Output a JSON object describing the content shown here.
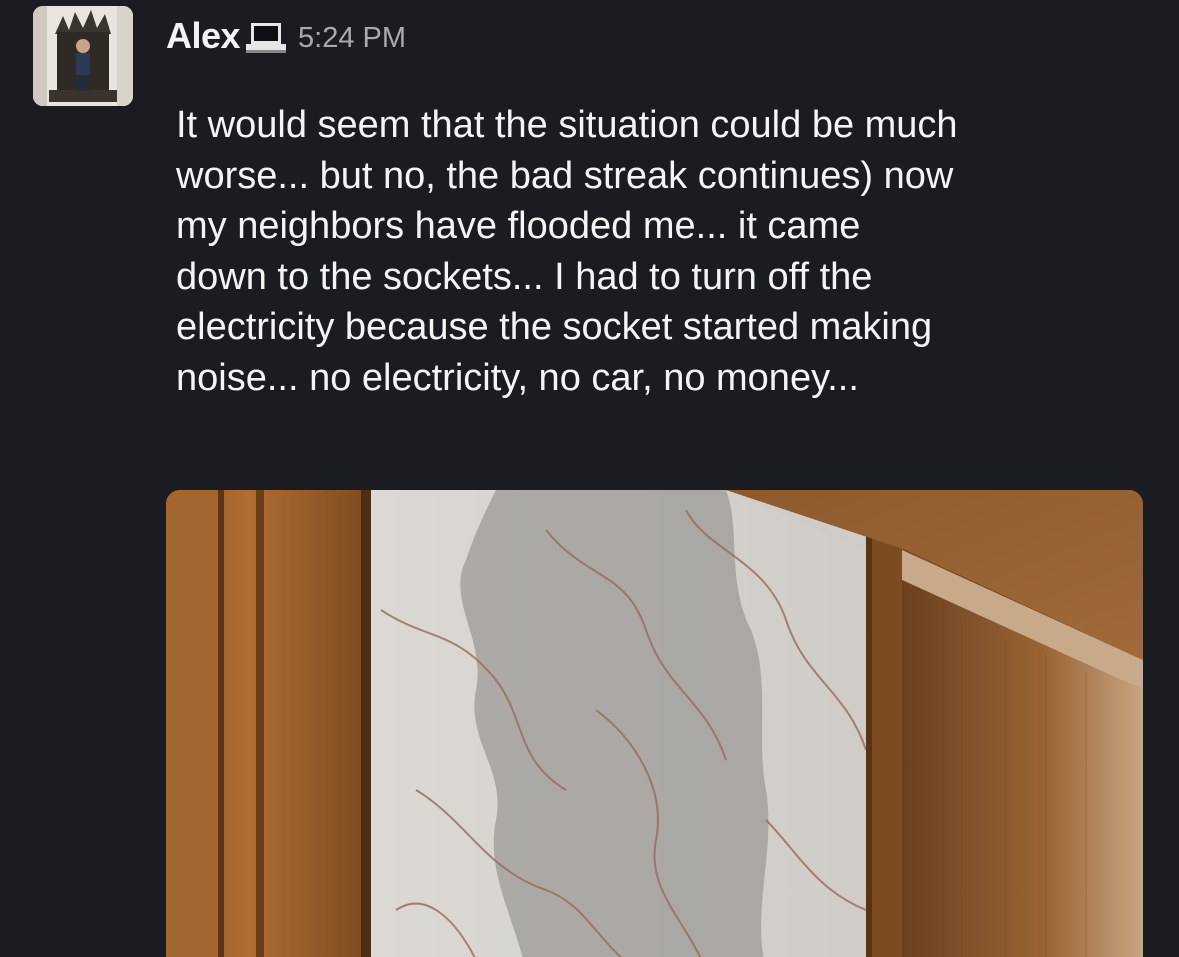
{
  "message": {
    "author": "Alex",
    "status_icon": "laptop-icon",
    "timestamp": "5:24 PM",
    "text": "It would seem that the situation could be much\nworse... but no, the bad streak continues) now\nmy neighbors have flooded me... it came\ndown to the sockets... I had to turn off the\nelectricity because the socket started making\nnoise... no electricity, no car, no money...",
    "attachment": {
      "kind": "photo"
    }
  },
  "colors": {
    "background": "#1b1c21",
    "text": "#f4f4f4",
    "timestamp": "#a9aaae"
  }
}
